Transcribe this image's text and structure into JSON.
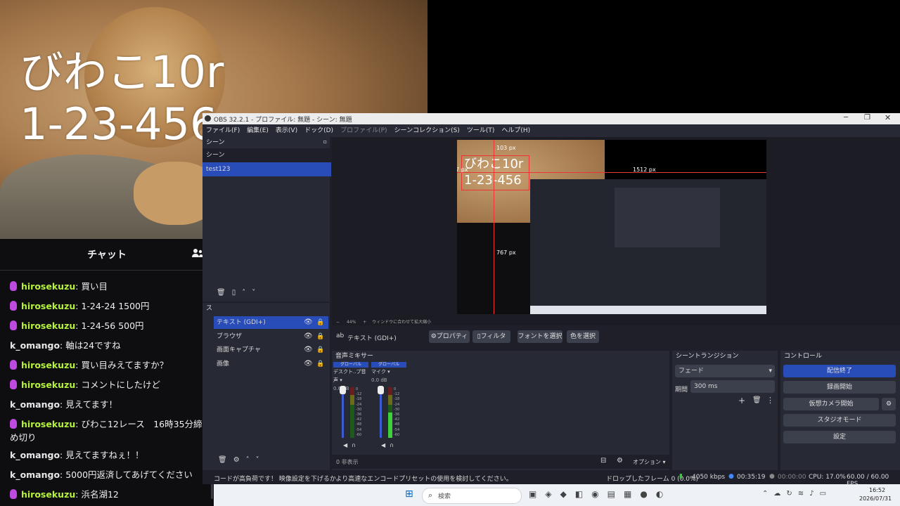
{
  "overlay": {
    "line1": "びわこ10r",
    "line2": "1-23-456"
  },
  "chat": {
    "title": "チャット",
    "messages": [
      {
        "user": "hirosekuzu",
        "text": "買い目",
        "badge": true
      },
      {
        "user": "hirosekuzu",
        "text": "1-24-24 1500円",
        "badge": true
      },
      {
        "user": "hirosekuzu",
        "text": "1-24-56 500円",
        "badge": true
      },
      {
        "user": "k_omango",
        "text": "軸は24ですね",
        "badge": false
      },
      {
        "user": "hirosekuzu",
        "text": "買い目みえてますか？",
        "badge": true
      },
      {
        "user": "hirosekuzu",
        "text": "コメントにしたけど",
        "badge": true
      },
      {
        "user": "k_omango",
        "text": "見えてます！",
        "badge": false
      },
      {
        "user": "hirosekuzu",
        "text": "びわこ12レース　16時35分締め切り",
        "badge": true
      },
      {
        "user": "k_omango",
        "text": "見えてますねぇ！！",
        "badge": false
      },
      {
        "user": "k_omango",
        "text": "5000円返済してあげてください",
        "badge": false
      },
      {
        "user": "hirosekuzu",
        "text": "浜名湖12",
        "badge": true
      }
    ]
  },
  "obs": {
    "title": "OBS 32.2.1 - プロファイル: 無題 - シーン: 無題",
    "menu": [
      "ファイル(F)",
      "編集(E)",
      "表示(V)",
      "ドック(D)",
      "プロファイル(P)",
      "シーンコレクション(S)",
      "ツール(T)",
      "ヘルプ(H)"
    ],
    "scenes": {
      "title": "シーン",
      "header": "シーン",
      "items": [
        "test123"
      ]
    },
    "sources": {
      "title": "ス",
      "items": [
        "テキスト (GDI+)",
        "ブラウザ",
        "画面キャプチャ",
        "画像"
      ]
    },
    "preview": {
      "dims": {
        "top": "103 px",
        "left": "37 px",
        "right": "1512 px",
        "bottom": "767 px"
      },
      "zoom": "44%",
      "fit_label": "ウィンドウに合わせて拡大縮小"
    },
    "source_toolbar": {
      "selected": "テキスト (GDI+)",
      "properties": "プロパティ",
      "filters": "フィルタ",
      "font": "フォントを選択",
      "color": "色を選択"
    },
    "mixer": {
      "title": "音声ミキサー",
      "channels": [
        {
          "scope": "グローバル",
          "name": "デスクト..プ音声",
          "db": "0.0 dB"
        },
        {
          "scope": "グローバル",
          "name": "マイク",
          "db": "0.0 dB"
        }
      ],
      "scale": [
        "0",
        "-12",
        "-18",
        "-24",
        "-30",
        "-36",
        "-42",
        "-48",
        "-54",
        "-60"
      ],
      "hidden_count": "0 非表示",
      "options": "オプション"
    },
    "transitions": {
      "title": "シーントランジション",
      "type": "フェード",
      "duration_label": "期間",
      "duration": "300 ms"
    },
    "controls": {
      "title": "コントロール",
      "stop_stream": "配信終了",
      "start_record": "録画開始",
      "virtual_cam": "仮想カメラ開始",
      "studio_mode": "スタジオモード",
      "settings": "設定"
    },
    "status": {
      "warning": "コードが高負荷です！ 映像設定を下げるかより高速なエンコードプリセットの使用を検討してください。",
      "dropped": "ドロップしたフレーム 0 (0.0%)",
      "bitrate": "4050 kbps",
      "stream_time": "00:35:19",
      "rec_time": "00:00:00",
      "cpu": "CPU: 17.0%",
      "fps": "60.00 / 60.00 FPS"
    }
  },
  "taskbar": {
    "search_placeholder": "検索",
    "time": "16:52",
    "date": "2026/07/31"
  },
  "colors": {
    "accent": "#284cb8",
    "chat_user_green": "#b6f23e",
    "badge_purple": "#bf4ae0"
  }
}
